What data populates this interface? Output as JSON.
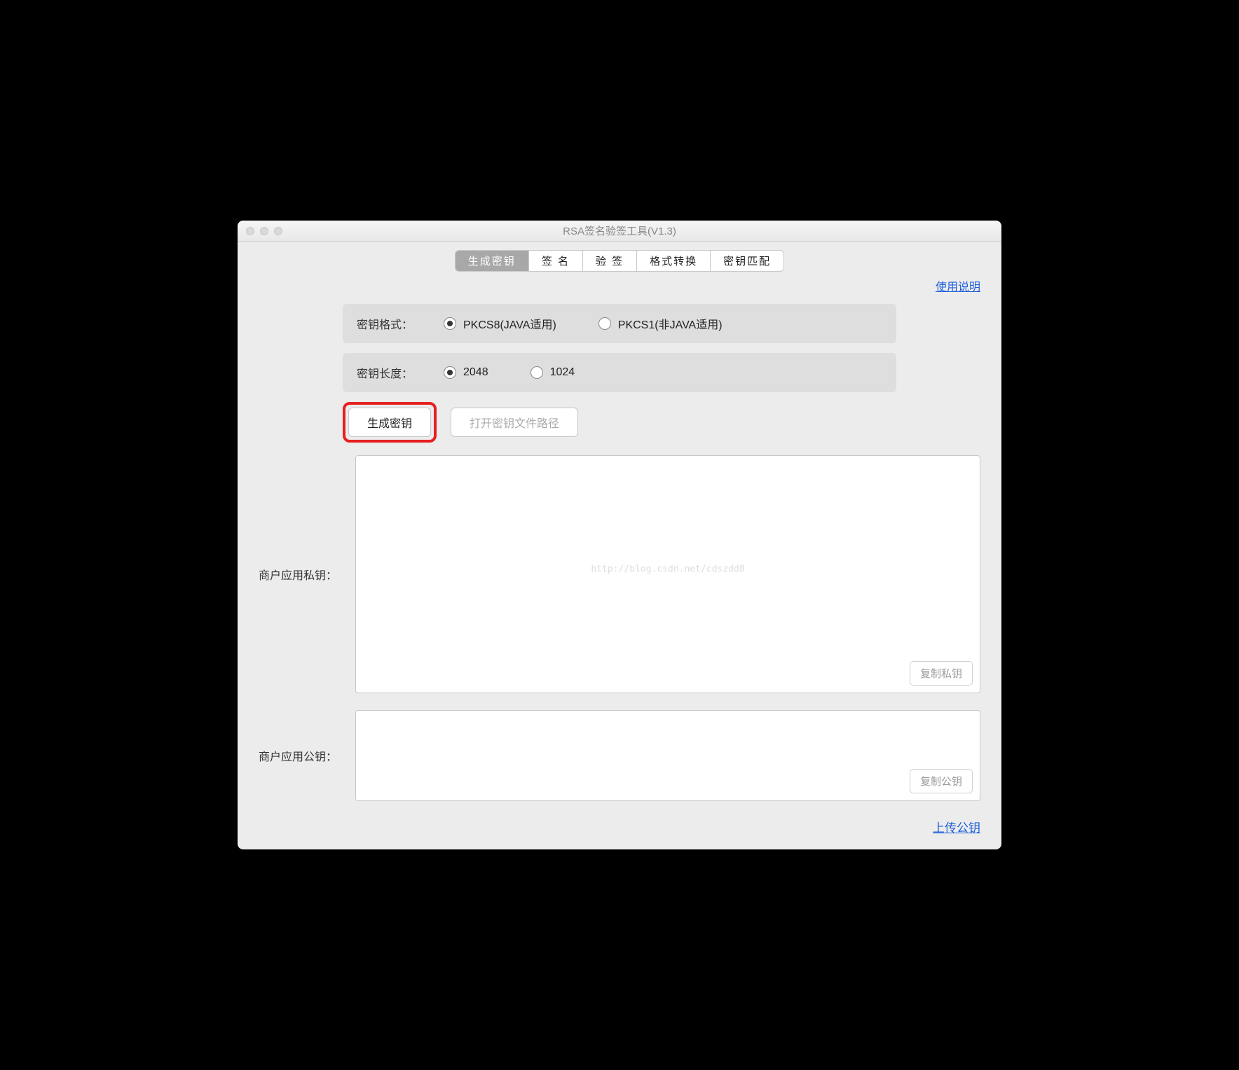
{
  "window": {
    "title": "RSA签名验签工具(V1.3)"
  },
  "tabs": {
    "items": [
      {
        "label": "生成密钥",
        "active": true
      },
      {
        "label": "签  名",
        "active": false
      },
      {
        "label": "验  签",
        "active": false
      },
      {
        "label": "格式转换",
        "active": false
      },
      {
        "label": "密钥匹配",
        "active": false
      }
    ]
  },
  "links": {
    "help": "使用说明",
    "upload": "上传公钥"
  },
  "options": {
    "format": {
      "label": "密钥格式：",
      "choices": [
        {
          "label": "PKCS8(JAVA适用)",
          "selected": true
        },
        {
          "label": "PKCS1(非JAVA适用)",
          "selected": false
        }
      ]
    },
    "length": {
      "label": "密钥长度：",
      "choices": [
        {
          "label": "2048",
          "selected": true
        },
        {
          "label": "1024",
          "selected": false
        }
      ]
    }
  },
  "buttons": {
    "generate": "生成密钥",
    "open_path": "打开密钥文件路径",
    "copy_private": "复制私钥",
    "copy_public": "复制公钥"
  },
  "fields": {
    "private_label": "商户应用私钥：",
    "public_label": "商户应用公钥：",
    "watermark": "http://blog.csdn.net/cdszdd8"
  }
}
